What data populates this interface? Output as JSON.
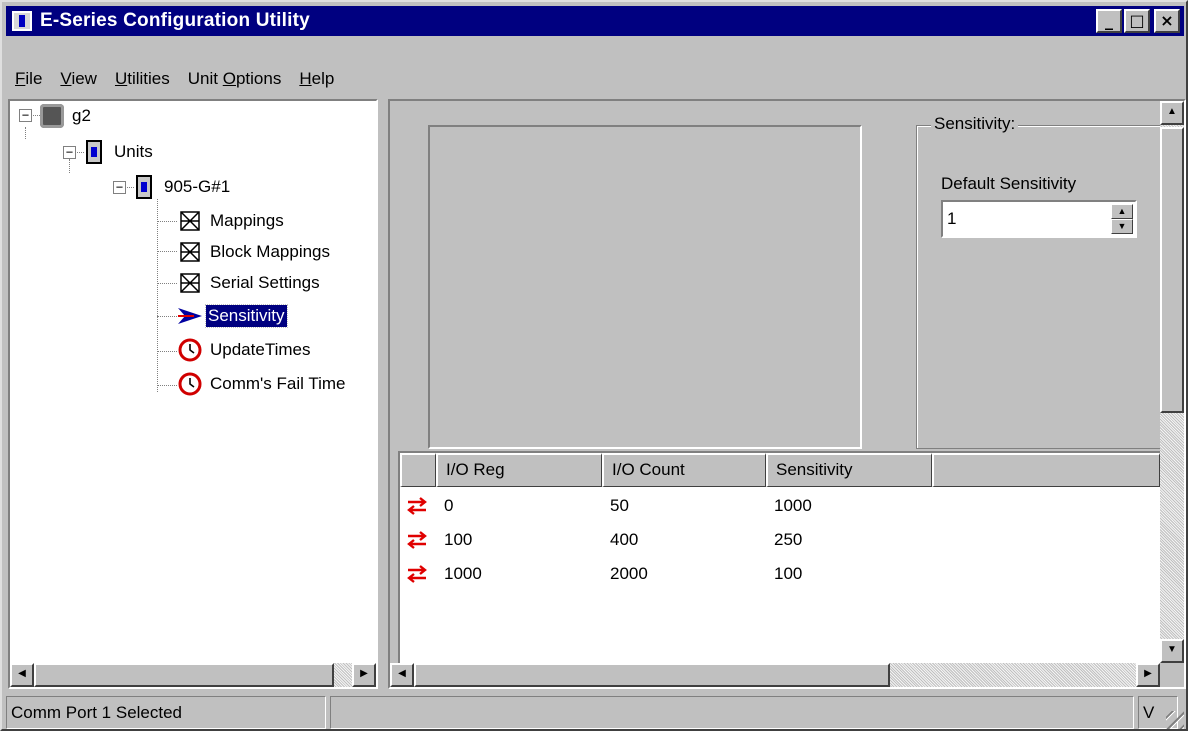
{
  "window": {
    "title": "E-Series Configuration Utility",
    "controls": [
      "_",
      "□",
      "×"
    ]
  },
  "menu": [
    {
      "label": "File",
      "mnemonic": "F",
      "rest": "ile"
    },
    {
      "label": "View",
      "mnemonic": "V",
      "rest": "iew"
    },
    {
      "label": "Utilities",
      "mnemonic": "U",
      "rest": "tilities"
    },
    {
      "label": "Unit Options",
      "pre": "Unit ",
      "mnemonic": "O",
      "rest": "ptions"
    },
    {
      "label": "Help",
      "mnemonic": "H",
      "rest": "elp"
    }
  ],
  "tree": {
    "root": "g2",
    "units": "Units",
    "unit": "905-G#1",
    "children": [
      {
        "label": "Mappings",
        "icon": "mapping-icon"
      },
      {
        "label": "Block Mappings",
        "icon": "mapping-icon"
      },
      {
        "label": "Serial Settings",
        "icon": "mapping-icon"
      },
      {
        "label": "Sensitivity",
        "icon": "arrow-icon",
        "selected": true
      },
      {
        "label": "UpdateTimes",
        "icon": "clock-icon"
      },
      {
        "label": "Comm's Fail Time",
        "icon": "clock-icon"
      }
    ]
  },
  "sensitivity_panel": {
    "group_title": "Sensitivity:",
    "field_label": "Default Sensitivity",
    "field_value": "1"
  },
  "table": {
    "columns": [
      "I/O Reg",
      "I/O Count",
      "Sensitivity"
    ],
    "rows": [
      [
        "0",
        "50",
        "1000"
      ],
      [
        "100",
        "400",
        "250"
      ],
      [
        "1000",
        "2000",
        "100"
      ]
    ]
  },
  "status": {
    "left": "Comm Port 1 Selected",
    "middle": "",
    "right": "V"
  },
  "colors": {
    "titlebar": "#000080",
    "face": "#c0c0c0",
    "swap_icon": "#e00000"
  }
}
